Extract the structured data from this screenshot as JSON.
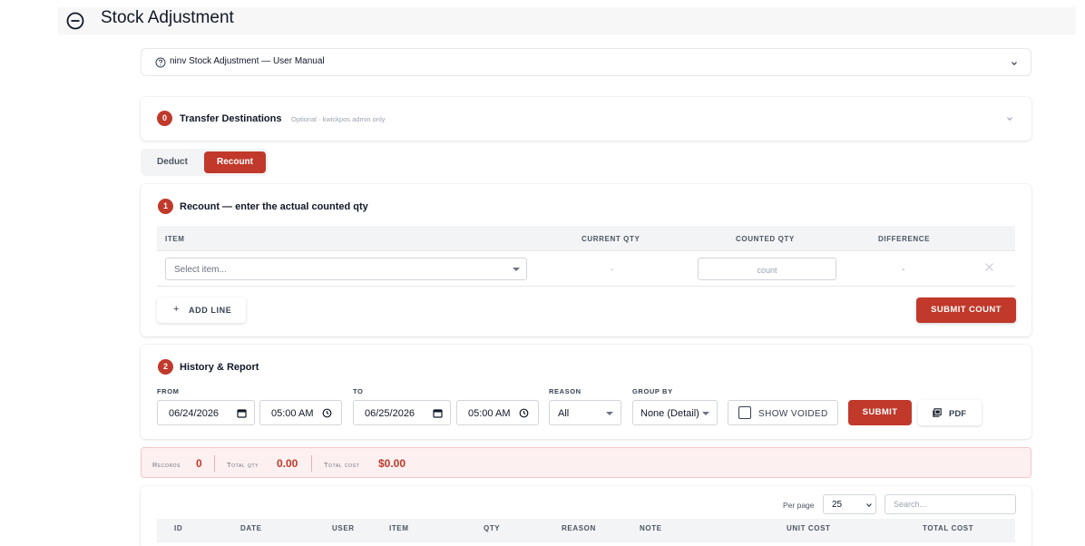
{
  "page": {
    "title": "Stock Adjustment"
  },
  "manual": {
    "label": "ninv Stock Adjustment — User Manual"
  },
  "transfer": {
    "badge": "0",
    "title": "Transfer Destinations",
    "note": "Optional · kwickpos admin only"
  },
  "mode": {
    "deduct_label": "Deduct",
    "recount_label": "Recount",
    "active": "Recount"
  },
  "recount": {
    "badge": "1",
    "title": "Recount — enter the actual counted qty",
    "columns": {
      "item": "ITEM",
      "current_qty": "CURRENT QTY",
      "counted_qty": "COUNTED QTY",
      "difference": "DIFFERENCE"
    },
    "row": {
      "item_placeholder": "Select item...",
      "current_qty": "-",
      "count_placeholder": "count",
      "difference": "-"
    },
    "add_line_label": "ADD LINE",
    "submit_label": "SUBMIT COUNT"
  },
  "history": {
    "badge": "2",
    "title": "History & Report",
    "from_label": "FROM",
    "from_date": "06/24/2026",
    "from_time": "05:00 AM",
    "to_label": "TO",
    "to_date": "06/25/2026",
    "to_time": "05:00 AM",
    "reason_label": "REASON",
    "reason_value": "All",
    "group_by_label": "GROUP BY",
    "group_by_value": "None (Detail)",
    "show_voided_label": "SHOW VOIDED",
    "show_voided_checked": false,
    "submit_label": "SUBMIT",
    "pdf_label": "PDF"
  },
  "stats": {
    "records_label": "Records",
    "records_value": "0",
    "total_qty_label": "Total qty",
    "total_qty_value": "0.00",
    "total_cost_label": "Total cost",
    "total_cost_value": "$0.00"
  },
  "records": {
    "per_page_label": "Per page",
    "per_page_value": "25",
    "search_placeholder": "Search...",
    "columns": [
      "ID",
      "DATE",
      "USER",
      "ITEM",
      "QTY",
      "REASON",
      "NOTE",
      "UNIT COST",
      "TOTAL COST"
    ]
  },
  "colors": {
    "accent": "#c0392b",
    "stats_bg": "#fdf0f0",
    "table_head_bg": "#f3f4f6"
  },
  "icons": {
    "collapse": "minus-circle-icon",
    "help": "question-circle-icon",
    "chevron": "chevron-down-icon",
    "calendar": "calendar-icon",
    "clock": "clock-icon",
    "remove": "close-icon",
    "plus": "plus-icon",
    "pdf": "pdf-icon"
  }
}
